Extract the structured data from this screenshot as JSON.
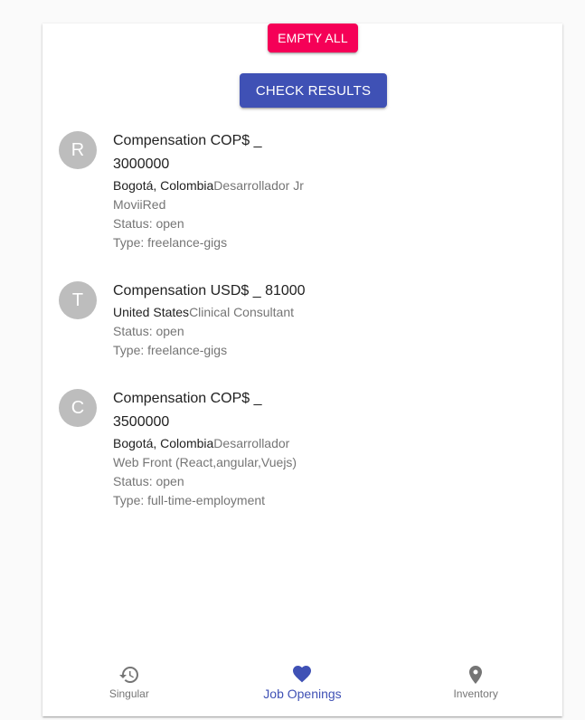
{
  "actions": {
    "empty_all_label": "EMPTY ALL",
    "check_results_label": "CHECK RESULTS"
  },
  "jobs": [
    {
      "avatar_letter": "R",
      "primary_line1": "Compensation COP$ _",
      "primary_line2": "3000000",
      "location": "Bogotá, Colombia",
      "title_line1": "Desarrollador Jr",
      "title_line2": "MoviiRed",
      "status": "Status: open",
      "type": "Type: freelance-gigs"
    },
    {
      "avatar_letter": "T",
      "primary_line1": "Compensation USD$ _ 81000",
      "location": "United States",
      "title_line1": "Clinical Consultant",
      "status": "Status: open",
      "type": "Type: freelance-gigs"
    },
    {
      "avatar_letter": "C",
      "primary_line1": "Compensation COP$ _",
      "primary_line2": "3500000",
      "location": "Bogotá, Colombia",
      "title_line1": "Desarrollador",
      "title_line2": "Web Front (React,angular,Vuejs)",
      "status": "Status: open",
      "type": "Type: full-time-employment"
    }
  ],
  "bottom_nav": {
    "items": [
      {
        "label": "Singular",
        "icon": "history-icon",
        "active": false
      },
      {
        "label": "Job Openings",
        "icon": "heart-icon",
        "active": true
      },
      {
        "label": "Inventory",
        "icon": "location-pin-icon",
        "active": false
      }
    ]
  },
  "colors": {
    "primary": "#3f51b5",
    "secondary": "#f50057",
    "avatar_bg": "#bdbdbd"
  }
}
